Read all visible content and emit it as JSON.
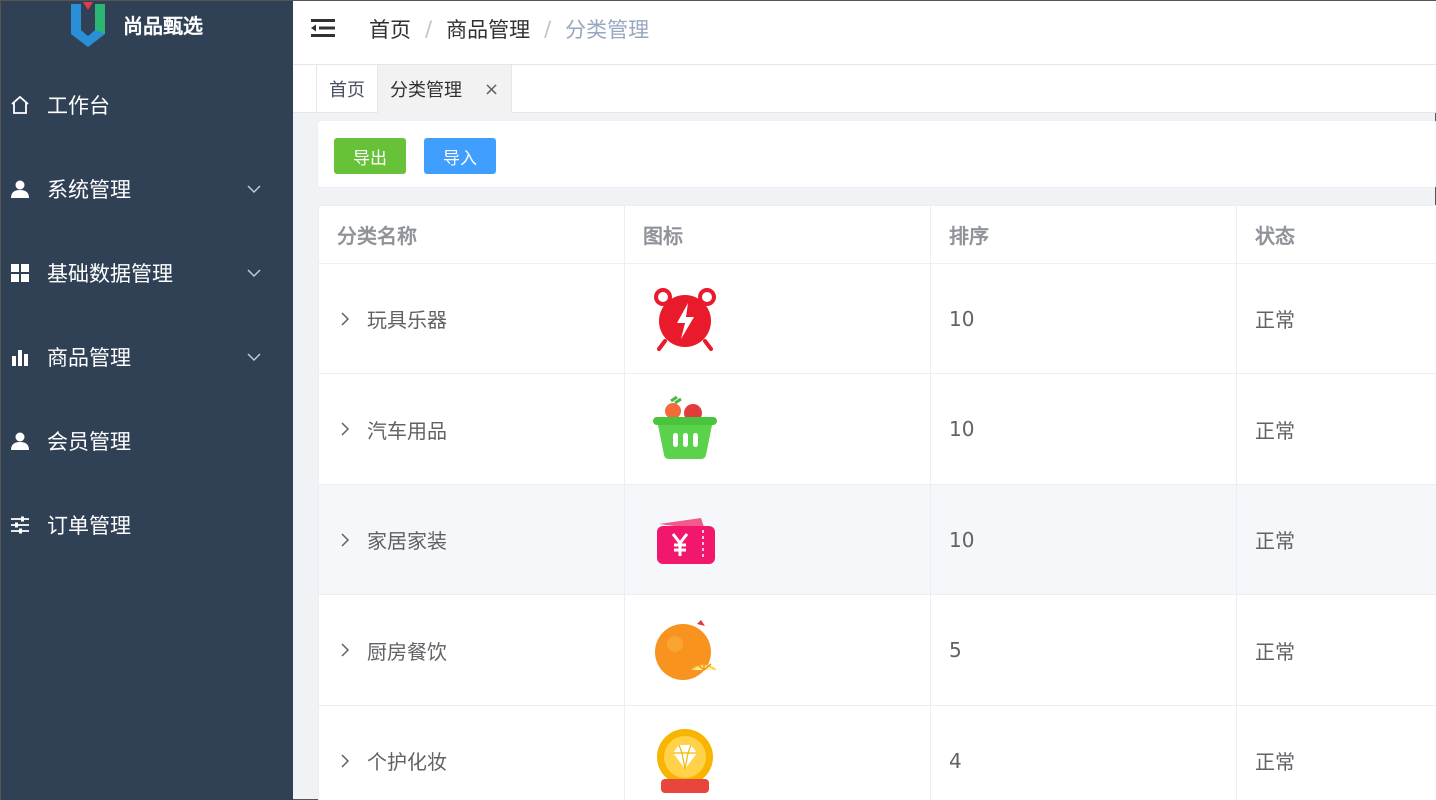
{
  "app": {
    "logo_text": "尚品甄选"
  },
  "sidebar": {
    "items": [
      {
        "label": "工作台",
        "icon": "home-icon"
      },
      {
        "label": "系统管理",
        "icon": "user-icon",
        "has_submenu": true
      },
      {
        "label": "基础数据管理",
        "icon": "grid-icon",
        "has_submenu": true
      },
      {
        "label": "商品管理",
        "icon": "bar-chart-icon",
        "has_submenu": true
      },
      {
        "label": "会员管理",
        "icon": "user-icon"
      },
      {
        "label": "订单管理",
        "icon": "sliders-icon"
      }
    ]
  },
  "breadcrumb": {
    "items": [
      "首页",
      "商品管理",
      "分类管理"
    ],
    "separator": "/"
  },
  "tags": [
    {
      "label": "首页"
    },
    {
      "label": "分类管理",
      "close": "×"
    }
  ],
  "toolbar": {
    "export_label": "导出",
    "import_label": "导入"
  },
  "table": {
    "columns": [
      "分类名称",
      "图标",
      "排序",
      "状态"
    ],
    "rows": [
      {
        "name": "玩具乐器",
        "icon": "alarm-clock-icon",
        "sort": "10",
        "status": "正常"
      },
      {
        "name": "汽车用品",
        "icon": "shopping-basket-icon",
        "sort": "10",
        "status": "正常"
      },
      {
        "name": "家居家装",
        "icon": "coupon-icon",
        "sort": "10",
        "status": "正常"
      },
      {
        "name": "厨房餐饮",
        "icon": "orange-icon",
        "sort": "5",
        "status": "正常"
      },
      {
        "name": "个护化妆",
        "icon": "diamond-badge-icon",
        "sort": "4",
        "status": "正常"
      }
    ]
  },
  "colors": {
    "sidebar_bg": "#304156",
    "export_button": "#67c23a",
    "import_button": "#409eff",
    "breadcrumb_current": "#97a8be",
    "row_hover": "#f5f7fa"
  }
}
